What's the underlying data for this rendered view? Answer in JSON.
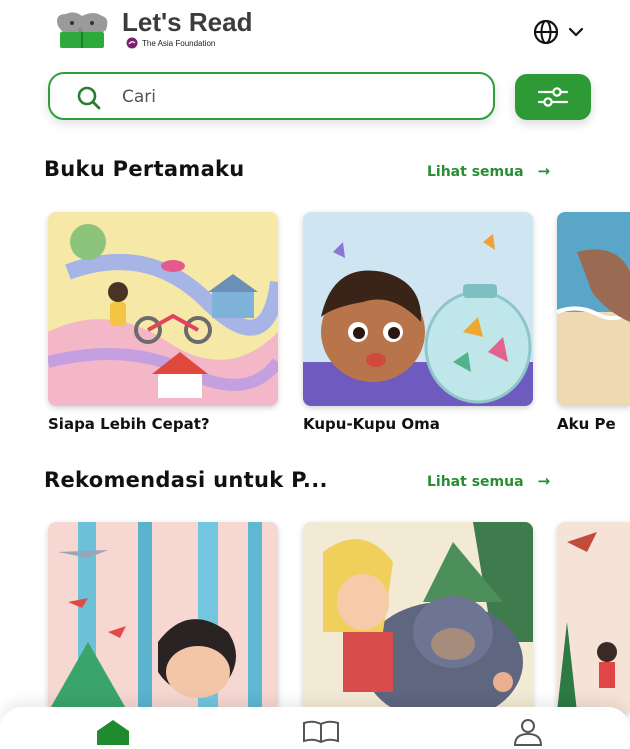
{
  "header": {
    "brand_title": "Let's Read",
    "brand_subtitle": "The Asia Foundation",
    "language_icon": "globe-icon",
    "chevron_icon": "chevron-down-icon"
  },
  "search": {
    "placeholder": "Cari",
    "value": "",
    "icon": "search-icon",
    "filter_icon": "sliders-icon"
  },
  "sections": [
    {
      "title": "Buku Pertamaku",
      "see_all": "Lihat semua",
      "books": [
        {
          "title": "Siapa Lebih Cepat?"
        },
        {
          "title": "Kupu-Kupu Oma"
        },
        {
          "title": "Aku Pe"
        }
      ]
    },
    {
      "title": "Rekomendasi untuk P...",
      "see_all": "Lihat semua",
      "books": [
        {
          "title": ""
        },
        {
          "title": ""
        },
        {
          "title": ""
        }
      ]
    }
  ],
  "bottom_nav": {
    "items": [
      {
        "icon": "home-icon",
        "active": true
      },
      {
        "icon": "book-icon",
        "active": false
      },
      {
        "icon": "profile-icon",
        "active": false
      }
    ]
  },
  "colors": {
    "accent": "#2e9a36",
    "accent_text": "#2a8d33",
    "text": "#111111"
  }
}
